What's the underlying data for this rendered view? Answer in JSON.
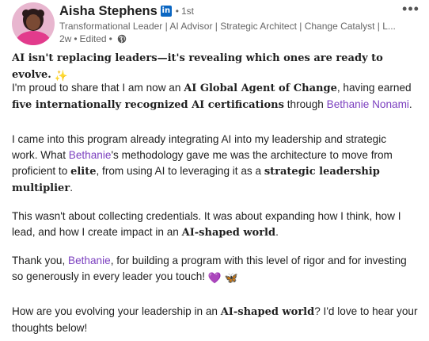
{
  "author": {
    "name": "Aisha Stephens",
    "linkedin_badge": "in",
    "connection_degree": "1st",
    "headline": "Transformational Leader | AI Advisor | Strategic Architect | Change Catalyst | L...",
    "time": "2w",
    "edited": "Edited"
  },
  "separators": {
    "dot": "•"
  },
  "menu": {
    "more": "•••"
  },
  "post": {
    "p1": {
      "text": "AI isn't replacing leaders—it's revealing which ones are ready to evolve.",
      "emoji": "✨"
    },
    "p2": {
      "a": "I'm proud to share that I am now an ",
      "b": "AI Global Agent of Change",
      "c": ", having earned",
      "d": "five internationally recognized AI certifications",
      "e": " through ",
      "mention": "Bethanie Nonami",
      "f": "."
    },
    "p3": {
      "line1": "I came into this program already integrating AI into my leadership and strategic",
      "a": "work. What ",
      "mention": "Bethanie",
      "b": "'s methodology gave me was the architecture to move from",
      "c": "proficient to ",
      "d": "elite",
      "e": ", from using AI to leveraging it as a ",
      "f": "strategic leadership",
      "g": "multiplier",
      "h": "."
    },
    "p4": {
      "line1": "This wasn't about collecting credentials. It was about expanding how I think, how I",
      "a": "lead, and how I create impact in an ",
      "b": "AI-shaped world",
      "c": "."
    },
    "p5": {
      "a": "Thank you, ",
      "mention": "Bethanie",
      "b": ", for building a program with this level of rigor and for investing",
      "c": "so generously in every leader you touch! ",
      "emoji1": "💜",
      "emoji2": "🦋"
    },
    "p6": {
      "a": "How are you evolving your leadership in an ",
      "b": "AI-shaped world",
      "c": "? I'd love to hear your",
      "d": "thoughts below!"
    }
  },
  "icons": {
    "visibility": "globe-icon"
  },
  "colors": {
    "mention": "#7b3fbf",
    "linkedin": "#0a66c2",
    "avatar_bg": "#e23b8c"
  }
}
